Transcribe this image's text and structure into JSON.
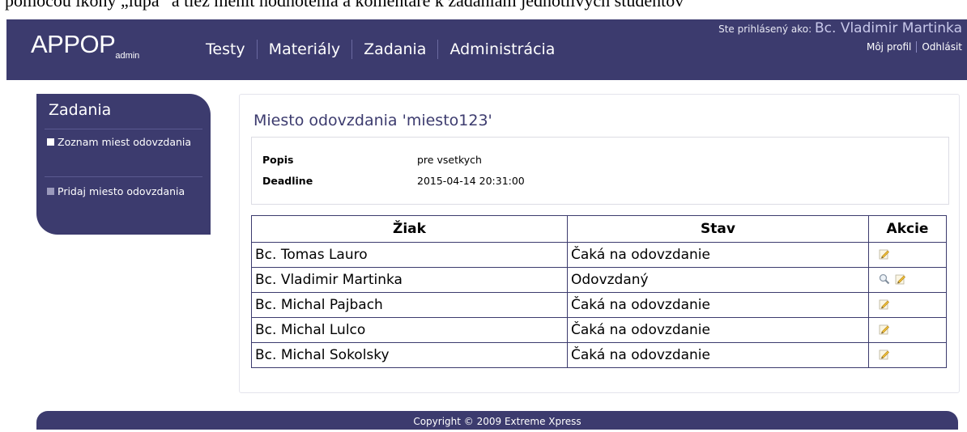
{
  "top_fragment": "pomocou ikony „lupa“ a tiež menit hodnotenia a komentare k zadaniam jednotlivych studentov",
  "header": {
    "logo_main": "APPOP",
    "logo_sub": "admin",
    "nav": [
      {
        "label": "Testy"
      },
      {
        "label": "Materiály"
      },
      {
        "label": "Zadania"
      },
      {
        "label": "Administrácia"
      }
    ],
    "logged_in_prefix": "Ste prihlásený ako: ",
    "user_name": "Bc. Vladimir Martinka",
    "profile_link": "Môj profil",
    "logout_link": "Odhlásit"
  },
  "sidebar": {
    "title": "Zadania",
    "items": [
      {
        "label": "Zoznam miest odovzdania",
        "active": true
      },
      {
        "label": "Pridaj miesto odovzdania",
        "active": false
      }
    ]
  },
  "main": {
    "title": "Miesto odovzdania 'miesto123'",
    "info": {
      "popis_label": "Popis",
      "popis_value": "pre vsetkych",
      "deadline_label": "Deadline",
      "deadline_value": "2015-04-14 20:31:00"
    },
    "table": {
      "headers": [
        "Žiak",
        "Stav",
        "Akcie"
      ],
      "rows": [
        {
          "ziak": "Bc. Tomas Lauro",
          "stav": "Čaká na odovzdanie",
          "actions": [
            "edit"
          ]
        },
        {
          "ziak": "Bc. Vladimir Martinka",
          "stav": "Odovzdaný",
          "actions": [
            "view",
            "edit"
          ]
        },
        {
          "ziak": "Bc. Michal Pajbach",
          "stav": "Čaká na odovzdanie",
          "actions": [
            "edit"
          ]
        },
        {
          "ziak": "Bc. Michal Lulco",
          "stav": "Čaká na odovzdanie",
          "actions": [
            "edit"
          ]
        },
        {
          "ziak": "Bc. Michal Sokolsky",
          "stav": "Čaká na odovzdanie",
          "actions": [
            "edit"
          ]
        }
      ]
    }
  },
  "footer": {
    "copyright": "Copyright © 2009 Extreme Xpress"
  },
  "colors": {
    "brand": "#3c3b6e",
    "active_bullet": "#ffffff",
    "inactive_bullet": "#9a99bc"
  },
  "icons": {
    "view": "magnifier-icon",
    "edit": "pencil-edit-icon"
  }
}
